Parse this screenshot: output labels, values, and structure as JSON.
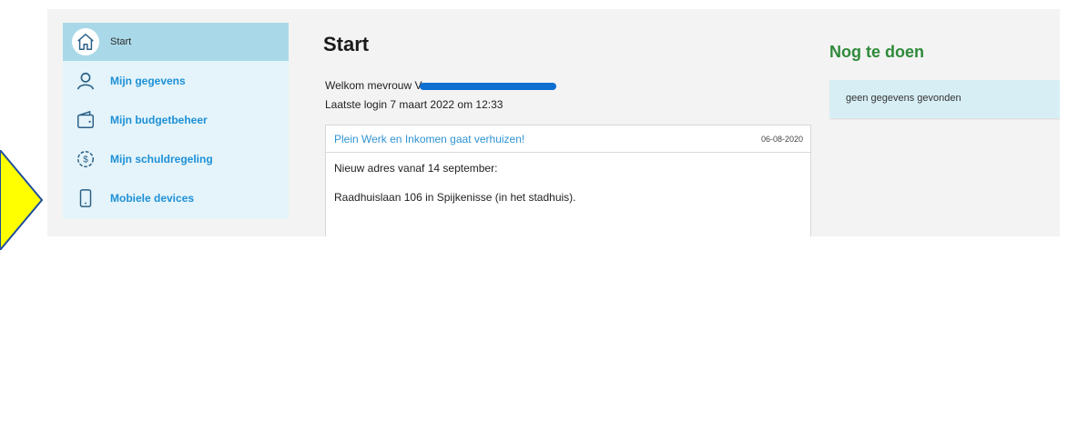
{
  "sidebar": {
    "items": [
      {
        "label": "Start",
        "icon": "home-icon",
        "active": true
      },
      {
        "label": "Mijn gegevens",
        "icon": "user-icon",
        "active": false
      },
      {
        "label": "Mijn budgetbeheer",
        "icon": "wallet-icon",
        "active": false
      },
      {
        "label": "Mijn schuldregeling",
        "icon": "debt-coin-icon",
        "active": false
      },
      {
        "label": "Mobiele devices",
        "icon": "mobile-device-icon",
        "active": false
      }
    ]
  },
  "main": {
    "title": "Start",
    "welcome_text": "Welkom mevrouw V",
    "last_login": "Laatste login 7 maart 2022 om 12:33",
    "news": {
      "title": "Plein Werk en Inkomen gaat verhuizen!",
      "date": "06-08-2020",
      "line1": "Nieuw adres vanaf 14 september:",
      "line2": "Raadhuislaan 106 in Spijkenisse (in het stadhuis)."
    }
  },
  "todo": {
    "title": "Nog te doen",
    "empty_text": "geen gegevens gevonden"
  },
  "colors": {
    "sidebar_bg": "#e4f4fa",
    "sidebar_active": "#a9d9e8",
    "link_blue": "#1e90d6",
    "todo_green": "#2f8a3a",
    "todo_box": "#d7eef5",
    "pointer_yellow": "#ffff00",
    "pointer_outline": "#1f4e9c"
  }
}
